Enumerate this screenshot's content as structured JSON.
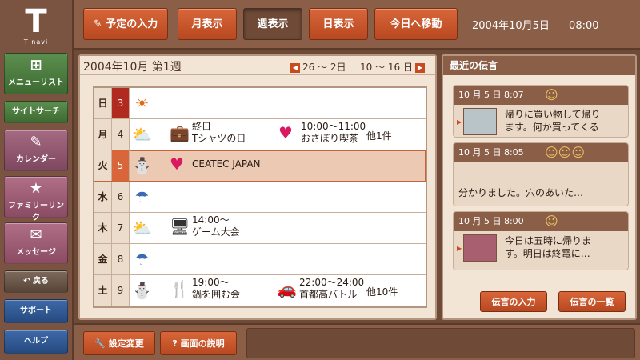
{
  "brand": {
    "mark": "T",
    "name": "T navi"
  },
  "sidebar": {
    "items": [
      {
        "label": "メニューリスト",
        "icon": "⊞",
        "color": "green"
      },
      {
        "label": "サイトサーチ",
        "icon": "",
        "color": "green"
      },
      {
        "label": "カレンダー",
        "icon": "✎",
        "color": "mauve"
      },
      {
        "label": "ファミリーリンク",
        "icon": "★",
        "color": "plum"
      },
      {
        "label": "メッセージ",
        "icon": "✉",
        "color": "plum"
      },
      {
        "label": "戻る",
        "icon": "↶",
        "color": "gray"
      },
      {
        "label": "サポート",
        "icon": "",
        "color": "navy"
      },
      {
        "label": "ヘルプ",
        "icon": "",
        "color": "navy"
      }
    ]
  },
  "toolbar": {
    "input_schedule": "予定の入力",
    "input_schedule_icon": "✎",
    "month_view": "月表示",
    "week_view": "週表示",
    "day_view": "日表示",
    "go_today": "今日へ移動",
    "date": "2004年10月5日",
    "time": "08:00"
  },
  "calendar": {
    "title": "2004年10月 第1週",
    "prev_range": "26 ～ 2日",
    "next_range": "10 ～ 16 日",
    "days": [
      {
        "weekday": "日",
        "day": "3",
        "weather": "☀",
        "type": "sun",
        "events": [],
        "more": ""
      },
      {
        "weekday": "月",
        "day": "4",
        "weather": "⛅",
        "type": "",
        "events": [
          {
            "icon": "💼",
            "line1": "終日",
            "line2": "Tシャツの日"
          },
          {
            "icon": "♥",
            "line1": "10:00～11:00",
            "line2": "おさぼり喫茶"
          }
        ],
        "more": "他1件"
      },
      {
        "weekday": "火",
        "day": "5",
        "weather": "⛄",
        "type": "today",
        "events": [
          {
            "icon": "♥",
            "line1": "CEATEC JAPAN",
            "line2": ""
          }
        ],
        "more": ""
      },
      {
        "weekday": "水",
        "day": "6",
        "weather": "☂",
        "type": "",
        "events": [],
        "more": ""
      },
      {
        "weekday": "木",
        "day": "7",
        "weather": "⛅",
        "type": "",
        "events": [
          {
            "icon": "🖥",
            "line1": "14:00～",
            "line2": "ゲーム大会"
          }
        ],
        "more": ""
      },
      {
        "weekday": "金",
        "day": "8",
        "weather": "☂",
        "type": "",
        "events": [],
        "more": ""
      },
      {
        "weekday": "土",
        "day": "9",
        "weather": "⛄",
        "type": "",
        "events": [
          {
            "icon": "🍴",
            "line1": "19:00～",
            "line2": "鍋を囲む会"
          },
          {
            "icon": "🚗",
            "line1": "22:00～24:00",
            "line2": "首都高バトル"
          }
        ],
        "more": "他10件"
      }
    ]
  },
  "messages": {
    "title": "最近の伝言",
    "items": [
      {
        "datetime": "10 月 5 日  8:07",
        "faces": "☺",
        "text1": "帰りに買い物して帰り",
        "text2": "ます。何か買ってくる"
      },
      {
        "datetime": "10 月 5 日  8:05",
        "faces": "☺☺☺",
        "text1": "分かりました。穴のあいた…",
        "text2": ""
      },
      {
        "datetime": "10 月 5 日  8:00",
        "faces": "☺",
        "text1": "今日は五時に帰りま",
        "text2": "す。明日は終電に…"
      }
    ],
    "input_button": "伝言の入力",
    "list_button": "伝言の一覧"
  },
  "bottom": {
    "settings": "設定変更",
    "settings_icon": "🔧",
    "help": "画面の説明",
    "help_icon": "?"
  }
}
